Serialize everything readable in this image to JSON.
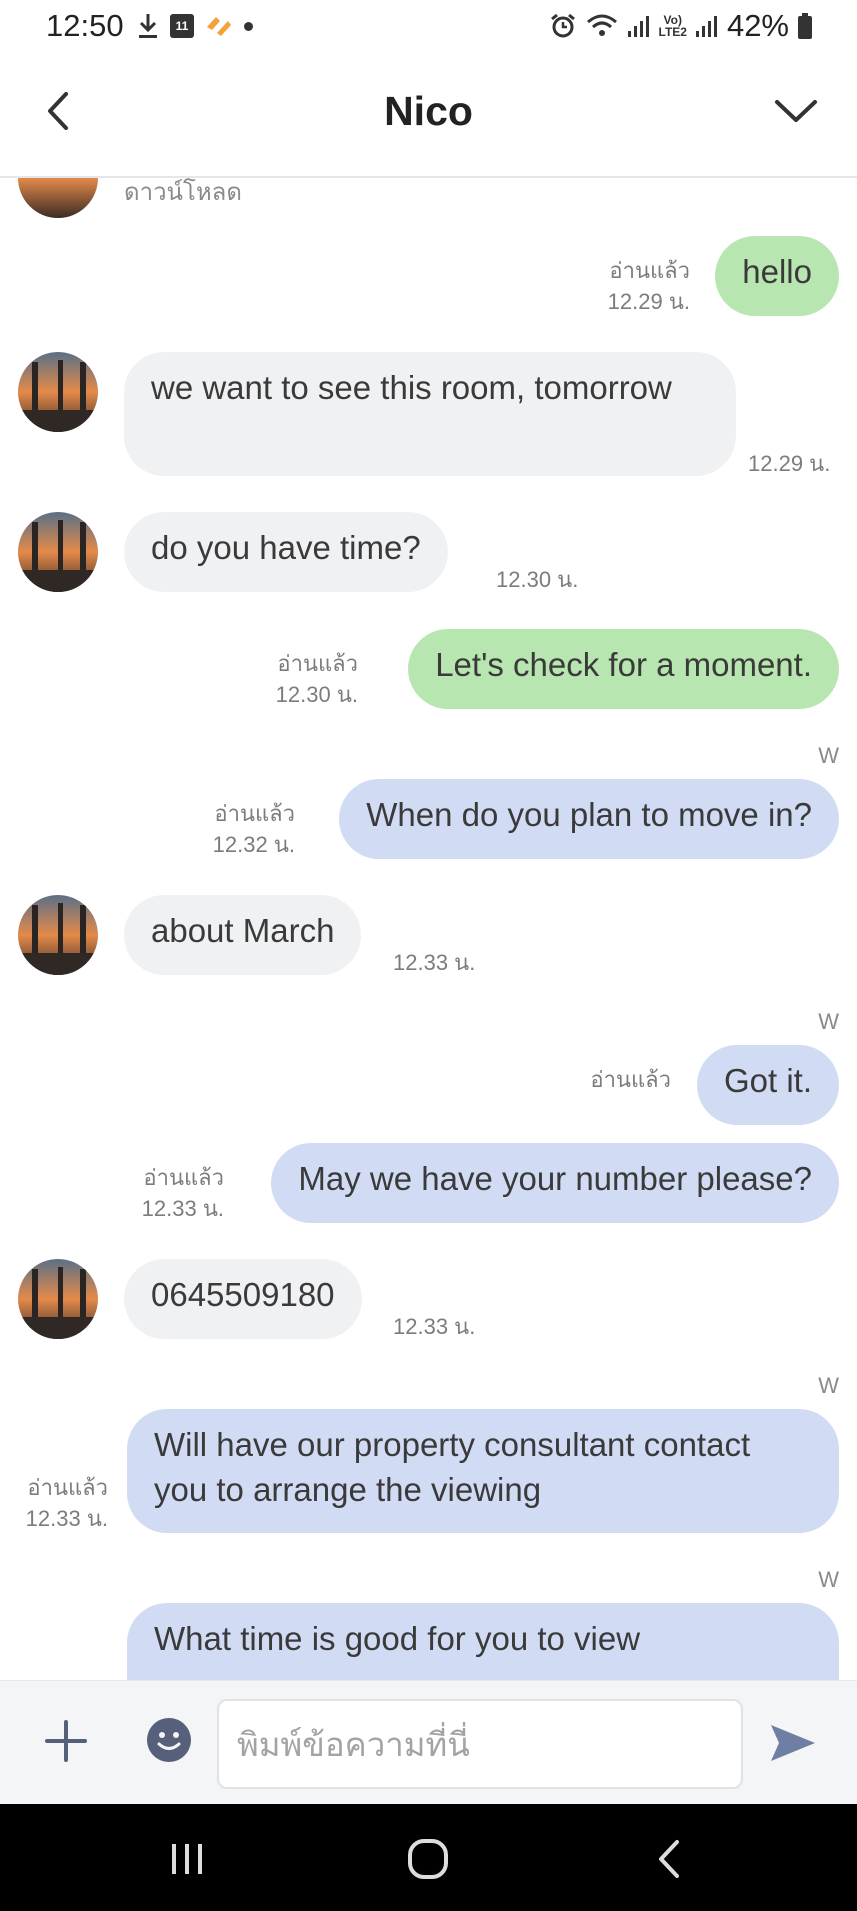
{
  "status_bar": {
    "time": "12:50",
    "calendar_day": "11",
    "volte_line1": "Vo)",
    "volte_line2": "LTE2",
    "battery_percent": "42%"
  },
  "header": {
    "title": "Nico"
  },
  "chat": {
    "partial_top_text": "ดาวน์โหลด",
    "read_label": "อ่านแล้ว",
    "sender_tag": "W",
    "messages": [
      {
        "text": "hello",
        "time": "12.29 น."
      },
      {
        "text": "we want to see this room, tomorrow",
        "time": "12.29 น."
      },
      {
        "text": "do you have time?",
        "time": "12.30 น."
      },
      {
        "text": "Let's check for a moment.",
        "time": "12.30 น."
      },
      {
        "text": "When do you plan to move in?",
        "time": "12.32 น."
      },
      {
        "text": "about March",
        "time": "12.33 น."
      },
      {
        "text": "Got it.",
        "time": ""
      },
      {
        "text": "May we have your number please?",
        "time": "12.33 น."
      },
      {
        "text": "0645509180",
        "time": "12.33 น."
      },
      {
        "text": "Will have our property consultant contact you to arrange the viewing",
        "time": "12.33 น."
      },
      {
        "text": "What time is good for you to view",
        "time": ""
      }
    ]
  },
  "input_bar": {
    "placeholder": "พิมพ์ข้อความที่นี่"
  },
  "colors": {
    "incoming_bubble": "#f0f1f3",
    "outgoing_green": "#b8e6b0",
    "outgoing_blue": "#d1dbf3",
    "send_icon": "#6f7fa3"
  }
}
